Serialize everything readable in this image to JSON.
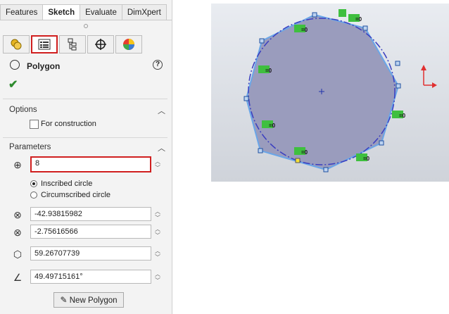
{
  "tabs": [
    "Features",
    "Sketch",
    "Evaluate",
    "DimXpert"
  ],
  "active_tab": "Sketch",
  "property_manager": {
    "title": "Polygon",
    "options": {
      "label": "Options",
      "construction_label": "For construction"
    },
    "parameters": {
      "label": "Parameters",
      "sides": "8",
      "inscribed_label": "Inscribed circle",
      "circumscribed_label": "Circumscribed circle",
      "center_x": "-42.93815982",
      "center_y": "-2.75616566",
      "diameter": "59.26707739",
      "angle": "49.49715161°"
    },
    "new_button": "New Polygon"
  },
  "graphics": {
    "relation_label": "=0",
    "polygon_color": "#5b9bd5",
    "fill_color": "#9a9cbd"
  }
}
